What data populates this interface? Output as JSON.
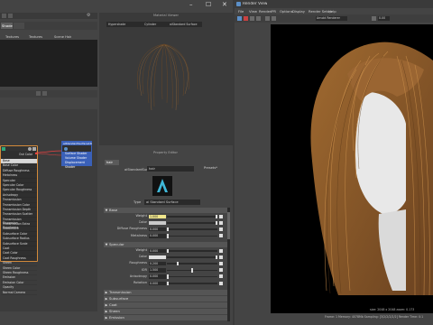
{
  "left_window": {
    "controls": {
      "minimize": "–",
      "maximize": "☐",
      "close": "✕"
    },
    "hypershade_tabs": [
      "Create",
      "Materials",
      "Textures",
      "Utilities",
      "Rendering",
      "Lights",
      "Shapes"
    ],
    "browser_tabs": [
      "Shader",
      "Textures",
      "Textures",
      "Scene Hair"
    ],
    "attr_node": {
      "name": "aiStandardSurface1",
      "output": "Out Color"
    },
    "attr_list": [
      "Base",
      "Base Color",
      "Diffuse Roughness",
      "Metalness",
      "Specular",
      "Specular Color",
      "Specular Roughness",
      "Anisotropy",
      "Transmission",
      "Transmission Color",
      "Transmission Depth",
      "Transmission Scatter",
      "Transmission Dispersion",
      "Transmission Extra Roughness",
      "Subsurface",
      "Subsurface Color",
      "Subsurface Radius",
      "Subsurface Scale",
      "Coat",
      "Coat Color",
      "Coat Roughness",
      "Sheen",
      "Sheen Color",
      "Sheen Roughness",
      "Emission",
      "Emission Color",
      "Opacity",
      "Normal Camera"
    ],
    "shading_group": {
      "name": "aiStandardSurface1SG",
      "rows": [
        "Surface Shader",
        "Volume Shader",
        "Displacement Shader"
      ]
    },
    "material_viewer": {
      "title": "Material Viewer",
      "dropdowns": [
        "Hypershade",
        "Cylinder",
        "aiStandard Surface"
      ]
    },
    "property_editor": {
      "title": "Property Editor",
      "tab": "hair",
      "node_type": "aiStandardSurface",
      "node_name": "hair",
      "presets_label": "Presets*",
      "type_label": "Type",
      "type_value": "ai Standard Surface",
      "sections": {
        "base": "Base",
        "specular": "Specular",
        "transmission": "Transmission",
        "subsurface": "Subsurface",
        "coat": "Coat",
        "sheen": "Sheen",
        "emission": "Emission"
      },
      "base_rows": [
        {
          "label": "Weight",
          "value": "1.000",
          "level": 1.0
        },
        {
          "label": "Color",
          "value": "",
          "level": 1.0
        },
        {
          "label": "Diffuse Roughness",
          "value": "0.000",
          "level": 0.0
        },
        {
          "label": "Metalness",
          "value": "0.000",
          "level": 0.0
        }
      ],
      "specular_rows": [
        {
          "label": "Weight",
          "value": "0.000",
          "level": 0.0
        },
        {
          "label": "Color",
          "value": "",
          "level": 1.0
        },
        {
          "label": "Roughness",
          "value": "0.200",
          "level": 0.2
        },
        {
          "label": "IOR",
          "value": "1.500",
          "level": 0.5
        },
        {
          "label": "Anisotropy",
          "value": "0.000",
          "level": 0.0
        },
        {
          "label": "Rotation",
          "value": "0.000",
          "level": 0.0
        }
      ]
    }
  },
  "render_view": {
    "title": "Render View",
    "menu": [
      "File",
      "View",
      "Render",
      "IPR",
      "Options",
      "Display",
      "Render Setup",
      "Help"
    ],
    "toolbar": {
      "camera": "persp",
      "renderer": "Arnold Renderer",
      "exposure": "0.00"
    },
    "status_top": "size: 2048 x 2048  zoom: 0.173",
    "status_bottom": "Frame: 1   Memory: 4078Mb   Sampling: [3/2/2/2/2/2]   Render Time: 0:1"
  },
  "colors": {
    "accent": "#5b8fc7",
    "hair": "#8a5a2a",
    "node_orange": "#d38a3a",
    "node_blue": "#3a60b8"
  }
}
